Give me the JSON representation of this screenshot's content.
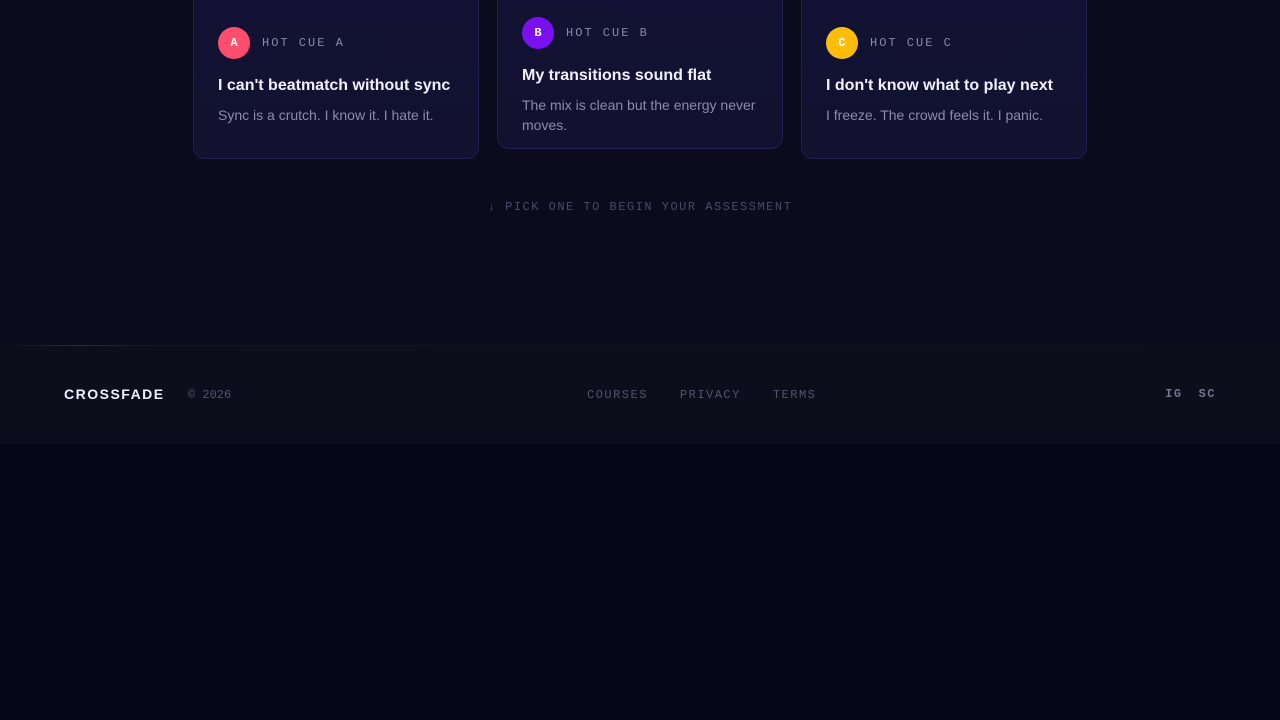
{
  "cards": [
    {
      "badge": "A",
      "badge_color": "#ff4d6d",
      "badge_text_color": "#ffffff",
      "label": "HOT CUE A",
      "title": "I can't beatmatch without sync",
      "description": "Sync is a crutch. I know it. I hate it."
    },
    {
      "badge": "B",
      "badge_color": "#7b10f0",
      "badge_text_color": "#ffffff",
      "label": "HOT CUE B",
      "title": "My transitions sound flat",
      "description": "The mix is clean but the energy never moves."
    },
    {
      "badge": "C",
      "badge_color": "#ffbd0a",
      "badge_text_color": "#ffffff",
      "label": "HOT CUE C",
      "title": "I don't know what to play next",
      "description": "I freeze. The crowd feels it. I panic."
    }
  ],
  "hint": {
    "arrow": "↓",
    "text": "PICK ONE TO BEGIN YOUR ASSESSMENT"
  },
  "footer": {
    "brand": "CROSSFADE",
    "copyright": "© 2026",
    "nav": [
      "COURSES",
      "PRIVACY",
      "TERMS"
    ],
    "social": [
      "IG",
      "SC"
    ]
  }
}
